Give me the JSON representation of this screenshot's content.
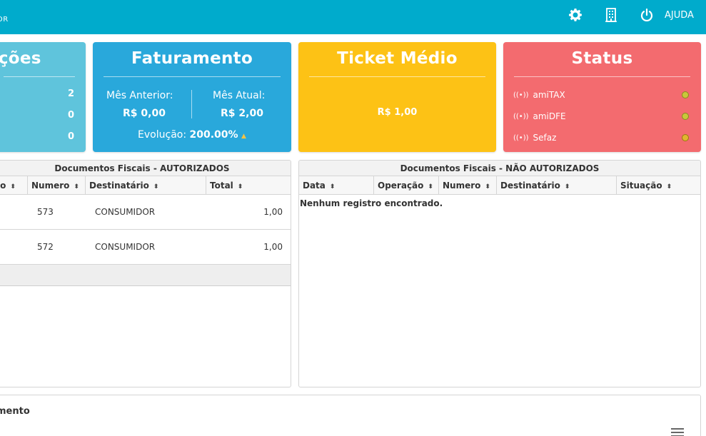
{
  "header": {
    "brand_fragment": "DR",
    "settings_icon": "gear-icon",
    "company_icon": "building-icon",
    "logout_icon": "power-icon",
    "help_label": "AJUDA"
  },
  "cards": {
    "operations": {
      "title": "ações",
      "values": [
        "2",
        "0",
        "0"
      ]
    },
    "billing": {
      "title": "Faturamento",
      "prev_label": "Mês Anterior:",
      "prev_value": "R$ 0,00",
      "curr_label": "Mês Atual:",
      "curr_value": "R$ 2,00",
      "evolution_label": "Evolução:",
      "evolution_value": "200.00%",
      "evolution_icon": "trend-up-icon"
    },
    "ticket": {
      "title": "Ticket Médio",
      "value": "R$ 1,00"
    },
    "status": {
      "title": "Status",
      "items": [
        {
          "label": "amiTAX",
          "icon": "broadcast-icon",
          "color": "#c8c83a"
        },
        {
          "label": "amiDFE",
          "icon": "broadcast-icon",
          "color": "#c8c83a"
        },
        {
          "label": "Sefaz",
          "icon": "broadcast-icon",
          "color": "#e0b62f"
        }
      ]
    }
  },
  "authorized": {
    "title": "Documentos Fiscais - AUTORIZADOS",
    "columns": [
      "io",
      "Numero",
      "Destinatário",
      "Total"
    ],
    "rows": [
      {
        "numero": "573",
        "destinatario": "CONSUMIDOR",
        "total": "1,00"
      },
      {
        "numero": "572",
        "destinatario": "CONSUMIDOR",
        "total": "1,00"
      }
    ]
  },
  "not_authorized": {
    "title": "Documentos Fiscais - NÃO AUTORIZADOS",
    "columns": [
      "Data",
      "Operação",
      "Numero",
      "Destinatário",
      "Situação"
    ],
    "empty_message": "Nenhum registro encontrado."
  },
  "bottom_panel": {
    "title": "mento"
  },
  "colors": {
    "topbar": "#00abcc",
    "operations": "#5fc4dc",
    "billing": "#29a8db",
    "ticket": "#fdc215",
    "status": "#f36b6f"
  }
}
